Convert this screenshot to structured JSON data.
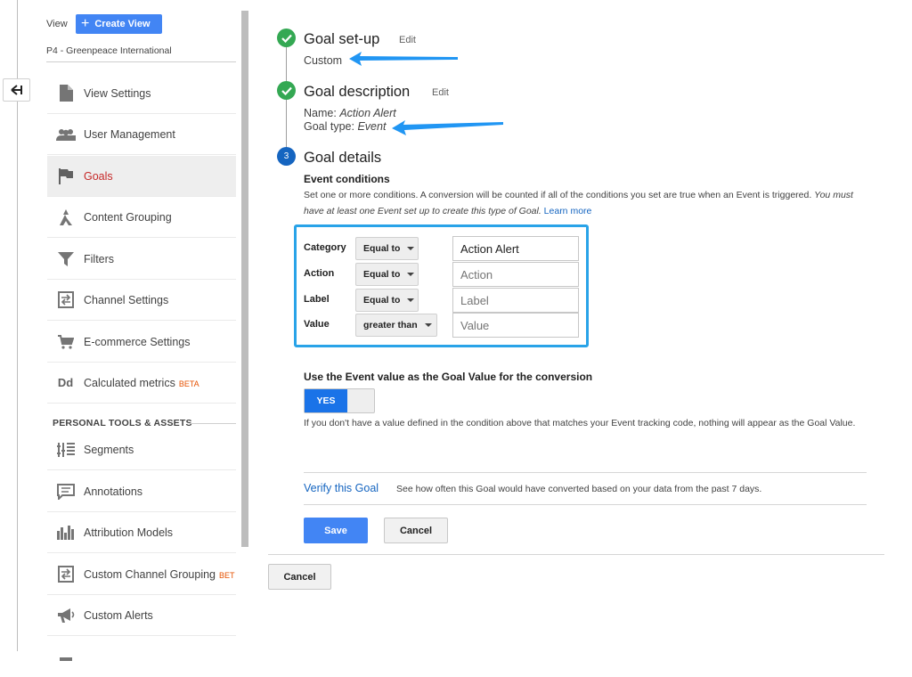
{
  "sidebar": {
    "view_label": "View",
    "create_view_label": "Create View",
    "account_name": "P4 - Greenpeace International",
    "items": [
      {
        "label": "View Settings",
        "icon": "document-icon"
      },
      {
        "label": "User Management",
        "icon": "people-icon"
      },
      {
        "label": "Goals",
        "icon": "flag-icon",
        "active": true
      },
      {
        "label": "Content Grouping",
        "icon": "grouping-icon"
      },
      {
        "label": "Filters",
        "icon": "filter-icon"
      },
      {
        "label": "Channel Settings",
        "icon": "channel-icon"
      },
      {
        "label": "E-commerce Settings",
        "icon": "cart-icon"
      },
      {
        "label": "Calculated metrics",
        "icon": "dd-icon",
        "badge": "BETA"
      }
    ],
    "section_title": "PERSONAL TOOLS & ASSETS",
    "tools": [
      {
        "label": "Segments",
        "icon": "segments-icon"
      },
      {
        "label": "Annotations",
        "icon": "annotation-icon"
      },
      {
        "label": "Attribution Models",
        "icon": "bar-chart-icon"
      },
      {
        "label": "Custom Channel Grouping",
        "icon": "channel-icon",
        "badge": "BET"
      },
      {
        "label": "Custom Alerts",
        "icon": "megaphone-icon"
      }
    ],
    "icon_dd_text": "Dd"
  },
  "goal": {
    "setup": {
      "title": "Goal set-up",
      "edit": "Edit",
      "value": "Custom"
    },
    "description": {
      "title": "Goal description",
      "edit": "Edit",
      "name_label": "Name:",
      "name_value": "Action Alert",
      "type_label": "Goal type:",
      "type_value": "Event"
    },
    "details": {
      "number": "3",
      "title": "Goal details"
    }
  },
  "conditions": {
    "heading": "Event conditions",
    "description": "Set one or more conditions. A conversion will be counted if all of the conditions you set are true when an Event is triggered.",
    "description_italic": "You must have at least one Event set up to create this type of Goal.",
    "learn_more": "Learn more",
    "rows": [
      {
        "label": "Category",
        "operator": "Equal to",
        "value": "Action Alert",
        "placeholder": ""
      },
      {
        "label": "Action",
        "operator": "Equal to",
        "value": "",
        "placeholder": "Action"
      },
      {
        "label": "Label",
        "operator": "Equal to",
        "value": "",
        "placeholder": "Label"
      },
      {
        "label": "Value",
        "operator": "greater than",
        "value": "",
        "placeholder": "Value"
      }
    ]
  },
  "goal_value": {
    "heading": "Use the Event value as the Goal Value for the conversion",
    "toggle_label": "YES",
    "note": "If you don't have a value defined in the condition above that matches your Event tracking code, nothing will appear as the Goal Value."
  },
  "verify": {
    "link": "Verify this Goal",
    "note": "See how often this Goal would have converted based on your data from the past 7 days."
  },
  "buttons": {
    "save": "Save",
    "cancel": "Cancel",
    "cancel_outer": "Cancel"
  },
  "colors": {
    "accent": "#4285f4",
    "check": "#34a853",
    "highlight": "#29a3e8",
    "active": "#c62828",
    "beta": "#e65100"
  }
}
